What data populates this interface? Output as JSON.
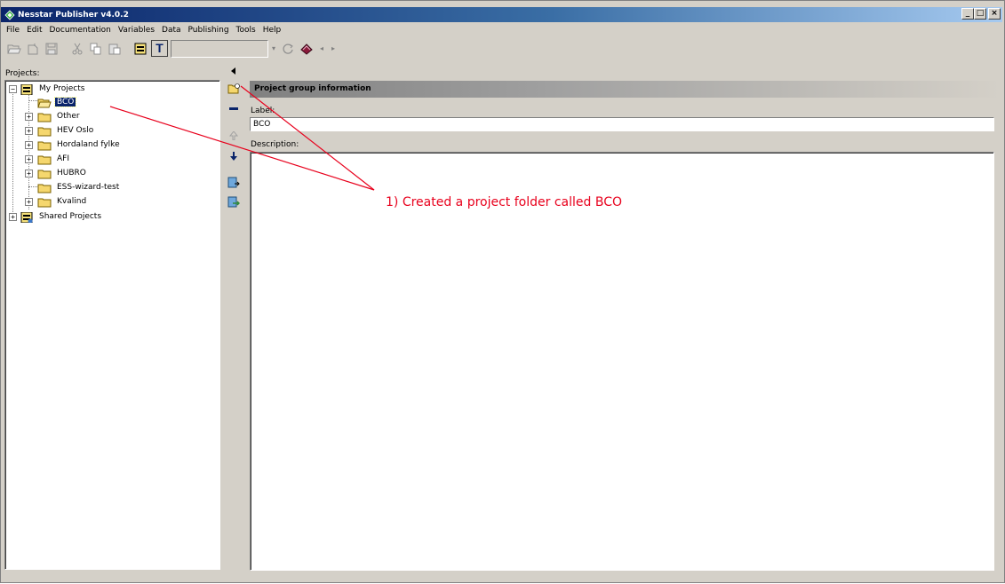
{
  "window": {
    "title": "Nesstar Publisher v4.0.2",
    "controls": {
      "minimize": "_",
      "maximize": "□",
      "close": "×"
    }
  },
  "menubar": {
    "items": [
      {
        "label": "File",
        "mnemonic": "F"
      },
      {
        "label": "Edit",
        "mnemonic": "E"
      },
      {
        "label": "Documentation",
        "mnemonic": "D"
      },
      {
        "label": "Variables",
        "mnemonic": "V"
      },
      {
        "label": "Data",
        "mnemonic": "a"
      },
      {
        "label": "Publishing",
        "mnemonic": "P"
      },
      {
        "label": "Tools",
        "mnemonic": "T"
      },
      {
        "label": "Help",
        "mnemonic": "H"
      }
    ]
  },
  "toolbar": {
    "combo_value": "",
    "t_button_label": "T"
  },
  "projects_panel": {
    "label": "Projects:",
    "tree": [
      {
        "label": "My Projects",
        "depth": 0,
        "expander": "−",
        "icon": "database-icon",
        "selected": false
      },
      {
        "label": "BCO",
        "depth": 1,
        "expander": "",
        "icon": "open-folder-icon",
        "selected": true
      },
      {
        "label": "Other",
        "depth": 1,
        "expander": "+",
        "icon": "folder-icon",
        "selected": false
      },
      {
        "label": "HEV Oslo",
        "depth": 1,
        "expander": "+",
        "icon": "folder-icon",
        "selected": false
      },
      {
        "label": "Hordaland fylke",
        "depth": 1,
        "expander": "+",
        "icon": "folder-icon",
        "selected": false
      },
      {
        "label": "AFI",
        "depth": 1,
        "expander": "+",
        "icon": "folder-icon",
        "selected": false
      },
      {
        "label": "HUBRO",
        "depth": 1,
        "expander": "+",
        "icon": "folder-icon",
        "selected": false
      },
      {
        "label": "ESS-wizard-test",
        "depth": 1,
        "expander": "",
        "icon": "folder-icon",
        "selected": false
      },
      {
        "label": "Kvalind",
        "depth": 1,
        "expander": "+",
        "icon": "folder-icon",
        "selected": false
      },
      {
        "label": "Shared Projects",
        "depth": 0,
        "expander": "+",
        "icon": "shared-database-icon",
        "selected": false
      }
    ]
  },
  "detail": {
    "header": "Project group information",
    "label_field_label": "Label:",
    "label_value": "BCO",
    "description_label": "Description:",
    "description_value": ""
  },
  "annotation": {
    "text": "1) Created a project folder called BCO",
    "color": "#e8001c"
  },
  "colors": {
    "selection": "#0a246a",
    "window_face": "#d4d0c8",
    "title_gradient_start": "#0a246a",
    "title_gradient_end": "#a6caf0"
  }
}
